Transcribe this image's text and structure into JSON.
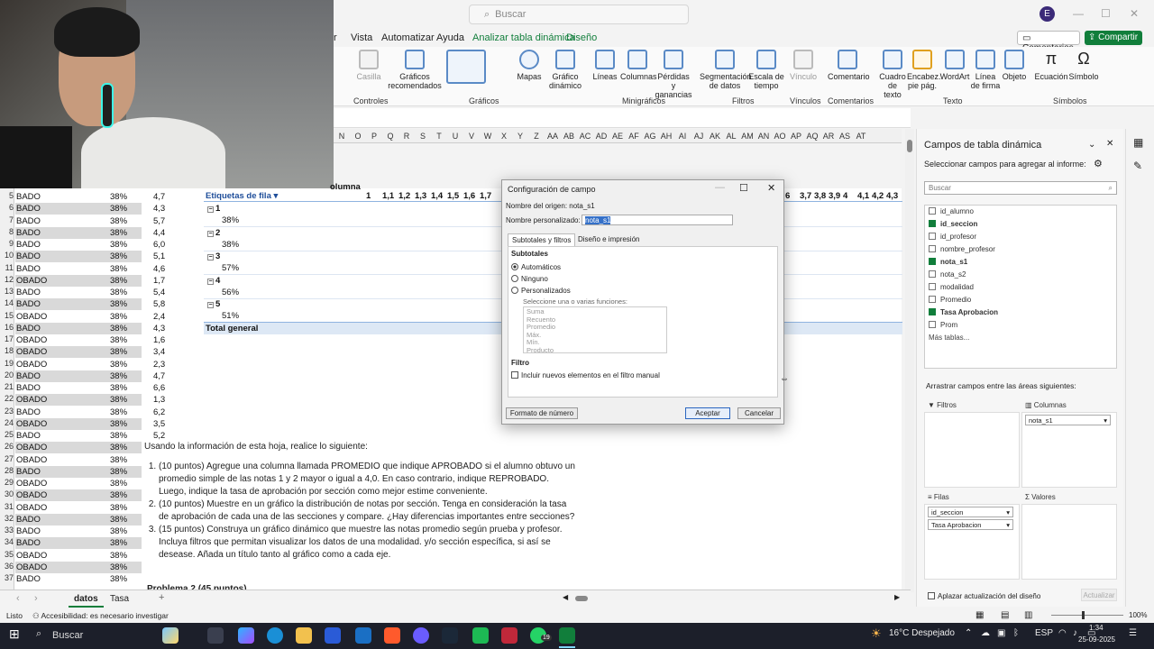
{
  "titlebar": {
    "search_placeholder": "Buscar",
    "avatar_initial": "E"
  },
  "menu": {
    "items": [
      "Vista",
      "Automatizar",
      "Ayuda",
      "Analizar tabla dinámica",
      "Diseño"
    ],
    "comments": "Comentarios",
    "share": "Compartir"
  },
  "ribbon": {
    "buttons": [
      "Casilla",
      "Gráficos recomendados",
      "Mapas",
      "Gráfico dinámico",
      "Líneas",
      "Columnas",
      "Pérdidas y ganancias",
      "Segmentación de datos",
      "Escala de tiempo",
      "Vínculo",
      "Comentario",
      "Cuadro de texto",
      "Encabez. pie pág.",
      "WordArt",
      "Línea de firma",
      "Objeto",
      "Ecuación",
      "Símbolo"
    ],
    "groups": [
      "Controles",
      "Gráficos",
      "Minigráficos",
      "Filtros",
      "Vínculos",
      "Comentarios",
      "Texto",
      "Símbolos"
    ]
  },
  "columns": [
    "N",
    "O",
    "P",
    "Q",
    "R",
    "S",
    "T",
    "U",
    "V",
    "W",
    "X",
    "Y",
    "Z",
    "AA",
    "AB",
    "AC",
    "AD",
    "AE",
    "AF",
    "AG",
    "AH",
    "AI",
    "AJ",
    "AK",
    "AL",
    "AM",
    "AN",
    "AO",
    "AP",
    "AQ",
    "AR",
    "AS",
    "AT"
  ],
  "pivot": {
    "header_labels": "Etiquetas de fila",
    "col_label": "olumna",
    "header_values": [
      "1",
      "1,1",
      "1,2",
      "1,3",
      "1,4",
      "1,5",
      "1,6",
      "1,7"
    ],
    "header_values_right": [
      "6",
      "3,7",
      "3,8",
      "3,9",
      "4",
      "4,1",
      "4,2",
      "4,3"
    ],
    "groups": [
      {
        "id": "1",
        "rate": "38%"
      },
      {
        "id": "2",
        "rate": "38%"
      },
      {
        "id": "3",
        "rate": "57%"
      },
      {
        "id": "4",
        "rate": "56%"
      },
      {
        "id": "5",
        "rate": "51%"
      }
    ],
    "total": "Total general"
  },
  "data_rows": [
    {
      "n": "5",
      "a": "BADO",
      "b": "38%",
      "c": "4,7",
      "g": false
    },
    {
      "n": "6",
      "a": "BADO",
      "b": "38%",
      "c": "4,3",
      "g": true
    },
    {
      "n": "7",
      "a": "BADO",
      "b": "38%",
      "c": "5,7",
      "g": false
    },
    {
      "n": "8",
      "a": "BADO",
      "b": "38%",
      "c": "4,4",
      "g": true
    },
    {
      "n": "9",
      "a": "BADO",
      "b": "38%",
      "c": "6,0",
      "g": false
    },
    {
      "n": "10",
      "a": "BADO",
      "b": "38%",
      "c": "5,1",
      "g": true
    },
    {
      "n": "11",
      "a": "BADO",
      "b": "38%",
      "c": "4,6",
      "g": false
    },
    {
      "n": "12",
      "a": "OBADO",
      "b": "38%",
      "c": "1,7",
      "g": true
    },
    {
      "n": "13",
      "a": "BADO",
      "b": "38%",
      "c": "5,4",
      "g": false
    },
    {
      "n": "14",
      "a": "BADO",
      "b": "38%",
      "c": "5,8",
      "g": true
    },
    {
      "n": "15",
      "a": "OBADO",
      "b": "38%",
      "c": "2,4",
      "g": false
    },
    {
      "n": "16",
      "a": "BADO",
      "b": "38%",
      "c": "4,3",
      "g": true
    },
    {
      "n": "17",
      "a": "OBADO",
      "b": "38%",
      "c": "1,6",
      "g": false
    },
    {
      "n": "18",
      "a": "OBADO",
      "b": "38%",
      "c": "3,4",
      "g": true
    },
    {
      "n": "19",
      "a": "OBADO",
      "b": "38%",
      "c": "2,3",
      "g": false
    },
    {
      "n": "20",
      "a": "BADO",
      "b": "38%",
      "c": "4,7",
      "g": true
    },
    {
      "n": "21",
      "a": "BADO",
      "b": "38%",
      "c": "6,6",
      "g": false
    },
    {
      "n": "22",
      "a": "OBADO",
      "b": "38%",
      "c": "1,3",
      "g": true
    },
    {
      "n": "23",
      "a": "BADO",
      "b": "38%",
      "c": "6,2",
      "g": false
    },
    {
      "n": "24",
      "a": "OBADO",
      "b": "38%",
      "c": "3,5",
      "g": true
    },
    {
      "n": "25",
      "a": "BADO",
      "b": "38%",
      "c": "5,2",
      "g": false
    },
    {
      "n": "26",
      "a": "OBADO",
      "b": "38%",
      "c": "",
      "g": true
    },
    {
      "n": "27",
      "a": "OBADO",
      "b": "38%",
      "c": "",
      "g": false
    },
    {
      "n": "28",
      "a": "BADO",
      "b": "38%",
      "c": "",
      "g": true
    },
    {
      "n": "29",
      "a": "OBADO",
      "b": "38%",
      "c": "",
      "g": false
    },
    {
      "n": "30",
      "a": "OBADO",
      "b": "38%",
      "c": "",
      "g": true
    },
    {
      "n": "31",
      "a": "OBADO",
      "b": "38%",
      "c": "",
      "g": false
    },
    {
      "n": "32",
      "a": "BADO",
      "b": "38%",
      "c": "",
      "g": true
    },
    {
      "n": "33",
      "a": "BADO",
      "b": "38%",
      "c": "",
      "g": false
    },
    {
      "n": "34",
      "a": "BADO",
      "b": "38%",
      "c": "",
      "g": true
    },
    {
      "n": "35",
      "a": "OBADO",
      "b": "38%",
      "c": "",
      "g": false
    },
    {
      "n": "36",
      "a": "OBADO",
      "b": "38%",
      "c": "",
      "g": true
    },
    {
      "n": "37",
      "a": "BADO",
      "b": "38%",
      "c": "",
      "g": false
    }
  ],
  "instructions": {
    "intro": "Usando la información de esta hoja, realice lo siguiente:",
    "items": [
      "(10 puntos) Agregue una columna llamada PROMEDIO que indique APROBADO si el alumno obtuvo un promedio simple de las notas 1 y 2 mayor o igual a 4,0. En caso contrario, indique REPROBADO. Luego, indique la tasa de aprobación por sección como mejor estime conveniente.",
      "(10 puntos) Muestre en un gráfico la distribución de notas por sección. Tenga en consideración la tasa de aprobación de cada una de las secciones y compare. ¿Hay diferencias importantes entre secciones?",
      "(15 puntos) Construya un gráfico dinámico que muestre las notas promedio según prueba y profesor. Incluya filtros que permitan visualizar los datos de una modalidad. y/o sección específica, si así se desease. Añada un título tanto al gráfico como a cada eje."
    ],
    "problem2": "Problema 2 (45 puntos)"
  },
  "dialog": {
    "title": "Configuración de campo",
    "source_label": "Nombre del origen:",
    "source_value": "nota_s1",
    "custom_label": "Nombre personalizado:",
    "custom_value": "nota_s1",
    "tab1": "Subtotales y filtros",
    "tab2": "Diseño e impresión",
    "subtotals": "Subtotales",
    "opt_auto": "Automáticos",
    "opt_none": "Ninguno",
    "opt_custom": "Personalizados",
    "fn_label": "Seleccione una o varias funciones:",
    "functions": [
      "Suma",
      "Recuento",
      "Promedio",
      "Máx.",
      "Mín.",
      "Producto"
    ],
    "filter": "Filtro",
    "filter_check": "Incluir nuevos elementos en el filtro manual",
    "number_format": "Formato de número",
    "accept": "Aceptar",
    "cancel": "Cancelar"
  },
  "pane": {
    "title": "Campos de tabla dinámica",
    "subtitle": "Seleccionar campos para agregar al informe:",
    "search": "Buscar",
    "fields": [
      {
        "name": "id_alumno",
        "checked": false
      },
      {
        "name": "id_seccion",
        "checked": true
      },
      {
        "name": "id_profesor",
        "checked": false
      },
      {
        "name": "nombre_profesor",
        "checked": false
      },
      {
        "name": "nota_s1",
        "checked": true
      },
      {
        "name": "nota_s2",
        "checked": false
      },
      {
        "name": "modalidad",
        "checked": false
      },
      {
        "name": "Promedio",
        "checked": false
      },
      {
        "name": "Tasa Aprobacion",
        "checked": true
      },
      {
        "name": "Prom",
        "checked": false
      }
    ],
    "more_tables": "Más tablas...",
    "drag_label": "Arrastrar campos entre las áreas siguientes:",
    "filters": "Filtros",
    "columns": "Columnas",
    "columns_chip": "nota_s1",
    "rows": "Filas",
    "rows_chips": [
      "id_seccion",
      "Tasa Aprobacion"
    ],
    "values": "Valores",
    "defer": "Aplazar actualización del diseño",
    "update": "Actualizar"
  },
  "sheets": [
    "datos",
    "Tasa"
  ],
  "status": {
    "ready": "Listo",
    "accessibility": "Accesibilidad: es necesario investigar",
    "zoom": "100%"
  },
  "taskbar": {
    "search": "Buscar",
    "weather": "16°C Despejado",
    "lang": "ESP",
    "time": "1:34",
    "date": "25-09-2025",
    "badge": "19"
  }
}
